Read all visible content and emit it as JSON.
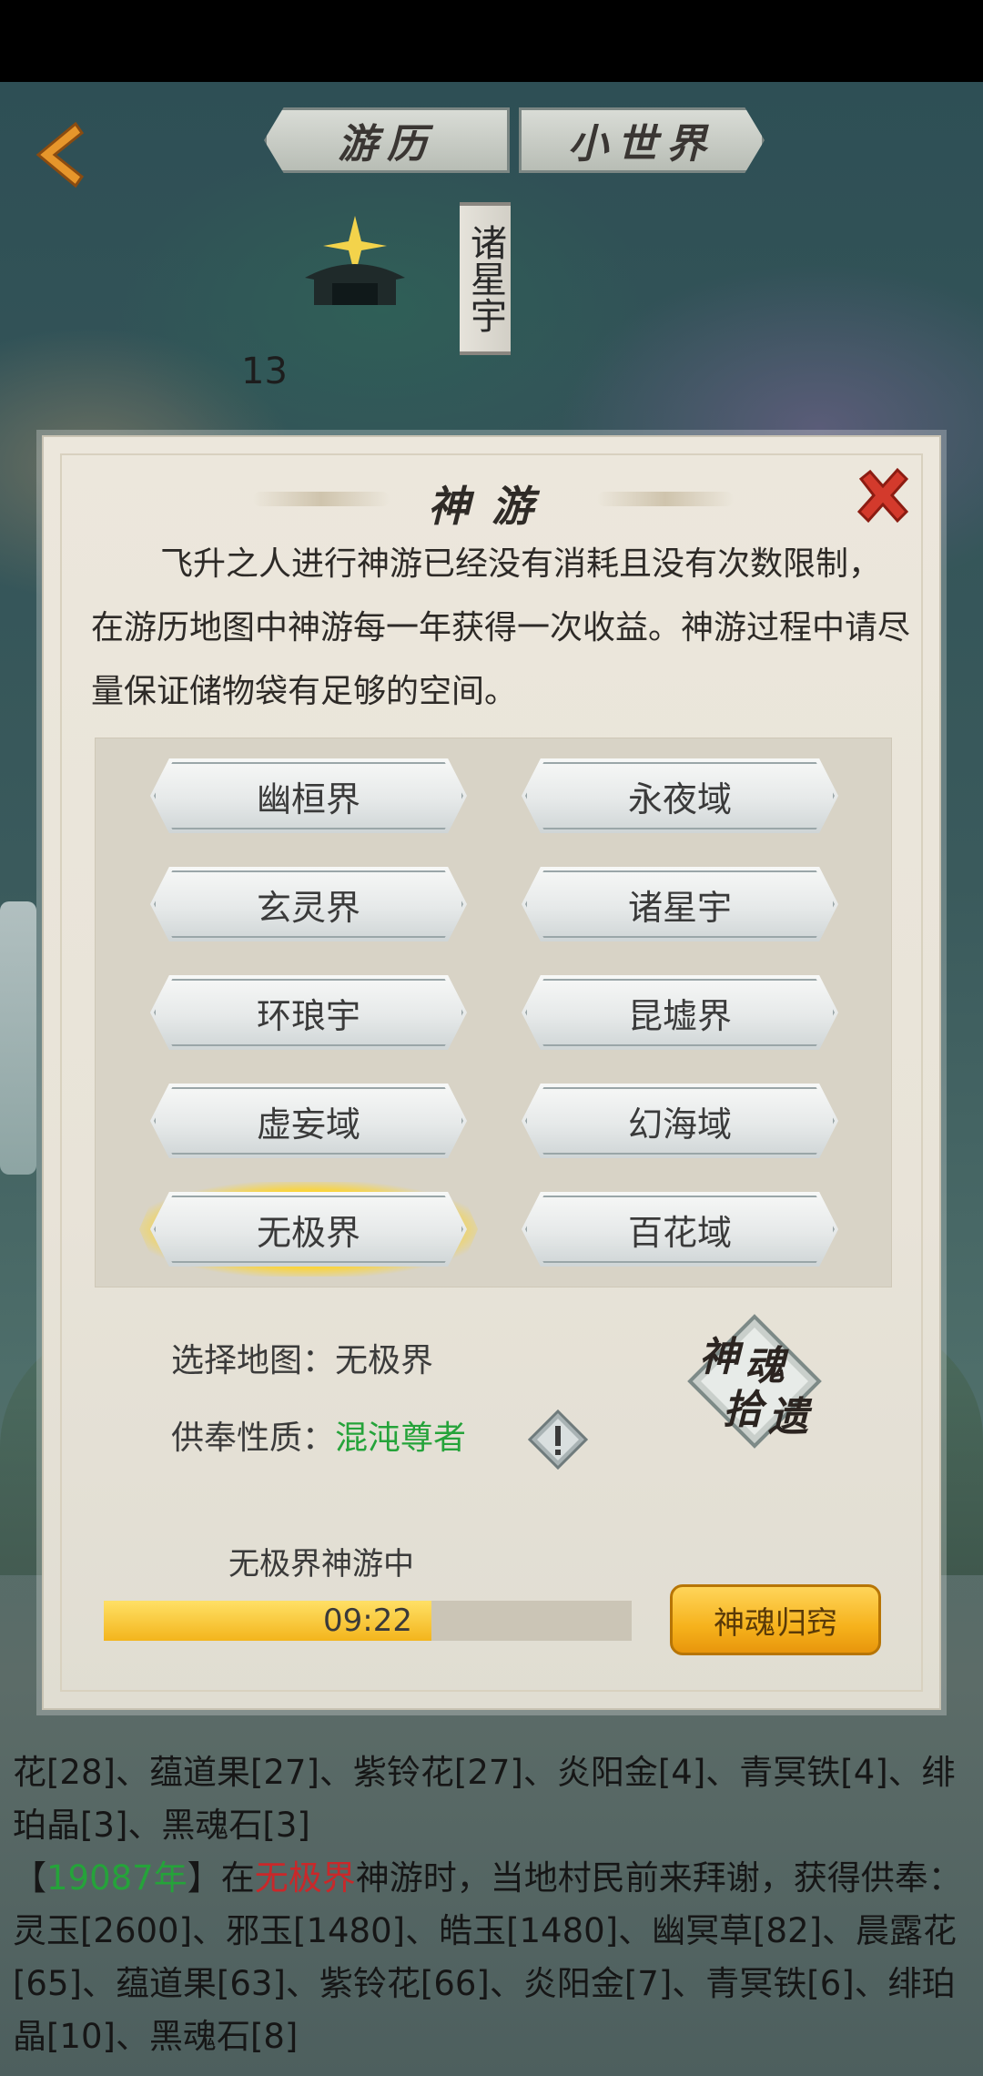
{
  "nav": {
    "tab_left": "游历",
    "tab_right": "小世界"
  },
  "map": {
    "location_label": "诸星宇",
    "number": "13"
  },
  "dialog": {
    "title": "神游",
    "description": "飞升之人进行神游已经没有消耗且没有次数限制，在游历地图中神游每一年获得一次收益。神游过程中请尽量保证储物袋有足够的空间。",
    "maps": [
      {
        "label": "幽桓界",
        "selected": false
      },
      {
        "label": "永夜域",
        "selected": false
      },
      {
        "label": "玄灵界",
        "selected": false
      },
      {
        "label": "诸星宇",
        "selected": false
      },
      {
        "label": "环琅宇",
        "selected": false
      },
      {
        "label": "昆墟界",
        "selected": false
      },
      {
        "label": "虚妄域",
        "selected": false
      },
      {
        "label": "幻海域",
        "selected": false
      },
      {
        "label": "无极界",
        "selected": true
      },
      {
        "label": "百花域",
        "selected": false
      }
    ],
    "selected_map_label": "选择地图：",
    "selected_map_value": "无极界",
    "offering_label": "供奉性质：",
    "offering_value": "混沌尊者",
    "soul_button": {
      "char1": "神",
      "char2": "魂",
      "char3": "拾",
      "char4": "遗"
    },
    "progress_label": "无极界神游中",
    "progress_time": "09:22",
    "progress_percent": 62,
    "return_button": "神魂归窍"
  },
  "log": {
    "line1": "花[28]、蕴道果[27]、紫铃花[27]、炎阳金[4]、青冥铁[4]、绯珀晶[3]、黑魂石[3]",
    "entry_open": "【",
    "entry_year": "19087年",
    "entry_close": "】",
    "entry_text_a": "在",
    "entry_place": "无极界",
    "entry_text_b": "神游时，当地村民前来拜谢，获得供奉：灵玉[2600]、邪玉[1480]、皓玉[1480]、幽冥草[82]、晨露花[65]、蕴道果[63]、紫铃花[66]、炎阳金[7]、青冥铁[6]、绯珀晶[10]、黑魂石[8]"
  },
  "colors": {
    "accent_green": "#25a33a",
    "accent_red": "#c9282a",
    "progress_gold": "#f3b51c"
  }
}
